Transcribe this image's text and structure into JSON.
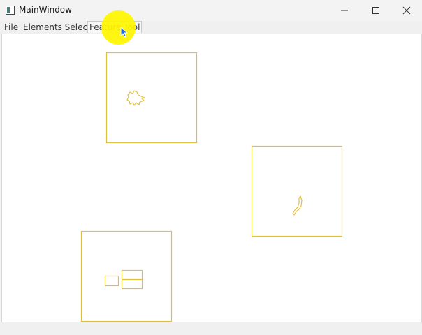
{
  "window": {
    "title": "MainWindow",
    "icon": "app-window-icon",
    "controls": [
      "minimize-icon",
      "maximize-icon",
      "close-icon"
    ]
  },
  "menu": {
    "items": [
      "File",
      "Elements Select",
      "Feature Tool"
    ],
    "active_index": 2
  },
  "colors": {
    "shape_stroke": "#e0c040",
    "canvas_background": "#ffffff",
    "highlight": "#fff500",
    "cursor": "#1e6fd9"
  },
  "canvas": {
    "elements": [
      "feature-box-bird",
      "feature-box-stroke",
      "feature-box-rectangles"
    ]
  }
}
